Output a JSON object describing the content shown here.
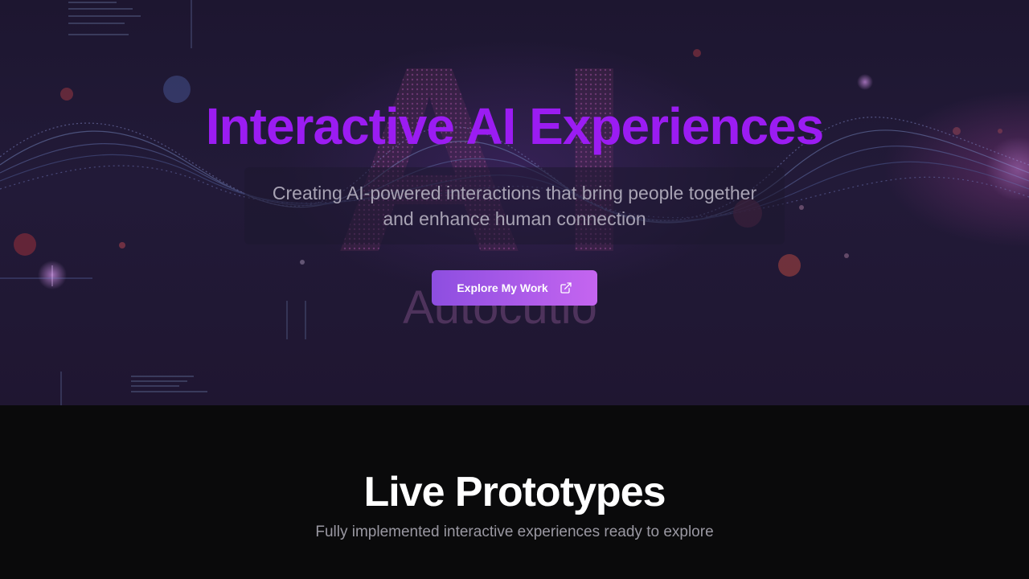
{
  "hero": {
    "title": "Interactive AI Experiences",
    "subtitle": "Creating AI-powered interactions that bring people together and enhance human connection",
    "cta_label": "Explore My Work",
    "cta_icon": "external-link-icon",
    "background_text": "AI",
    "background_caption": "Autocutio",
    "title_color": "#9b1cf2",
    "cta_gradient": [
      "#8d4ee0",
      "#c565f0"
    ]
  },
  "section": {
    "title": "Live Prototypes",
    "subtitle": "Fully implemented interactive experiences ready to explore"
  }
}
